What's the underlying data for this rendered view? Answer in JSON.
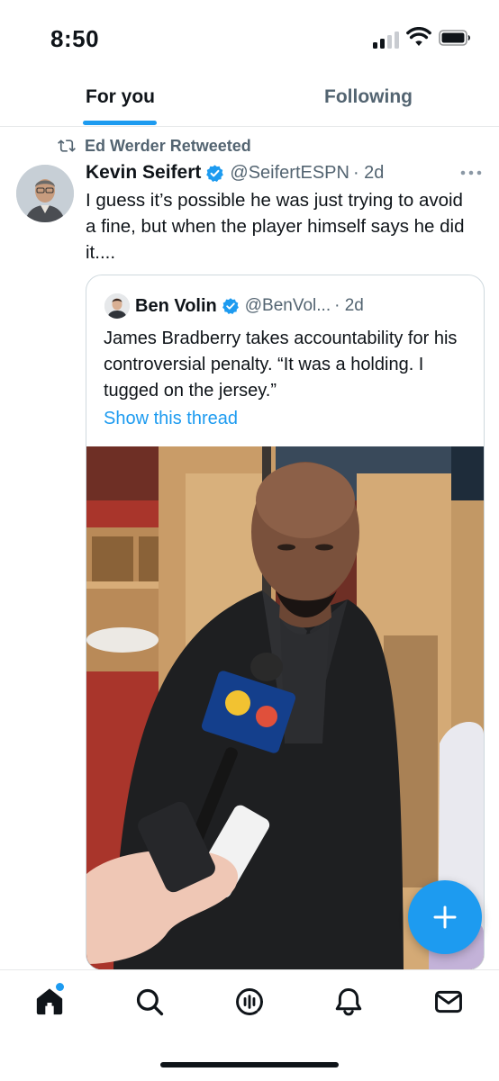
{
  "status_bar": {
    "time": "8:50",
    "icons": [
      "cellular-signal-icon",
      "wifi-icon",
      "battery-icon"
    ]
  },
  "tabs": [
    {
      "label": "For you",
      "selected": true
    },
    {
      "label": "Following",
      "selected": false
    }
  ],
  "tweet": {
    "retweeted_by": "Ed Werder Retweeted",
    "author_name": "Kevin Seifert",
    "author_handle": "@SeifertESPN",
    "time": "· 2d",
    "verified": true,
    "text": "I guess it’s possible he was just trying to avoid a fine, but when the player himself says he did it....",
    "quote": {
      "author_name": "Ben Volin",
      "author_handle": "@BenVol...",
      "time": "· 2d",
      "verified": true,
      "text": "James Bradberry takes accountability for his controversial penalty. “It was a holding. I tugged on the jersey.”",
      "show_thread": "Show this thread",
      "media": "photo"
    }
  },
  "fab": {
    "icon": "plus-icon"
  },
  "bottom_nav": [
    "home-icon",
    "search-icon",
    "spaces-icon",
    "notifications-icon",
    "messages-icon"
  ],
  "colors": {
    "accent": "#1d9bf0",
    "text_primary": "#0f1419",
    "text_secondary": "#536471",
    "border": "#e7e9ea"
  }
}
